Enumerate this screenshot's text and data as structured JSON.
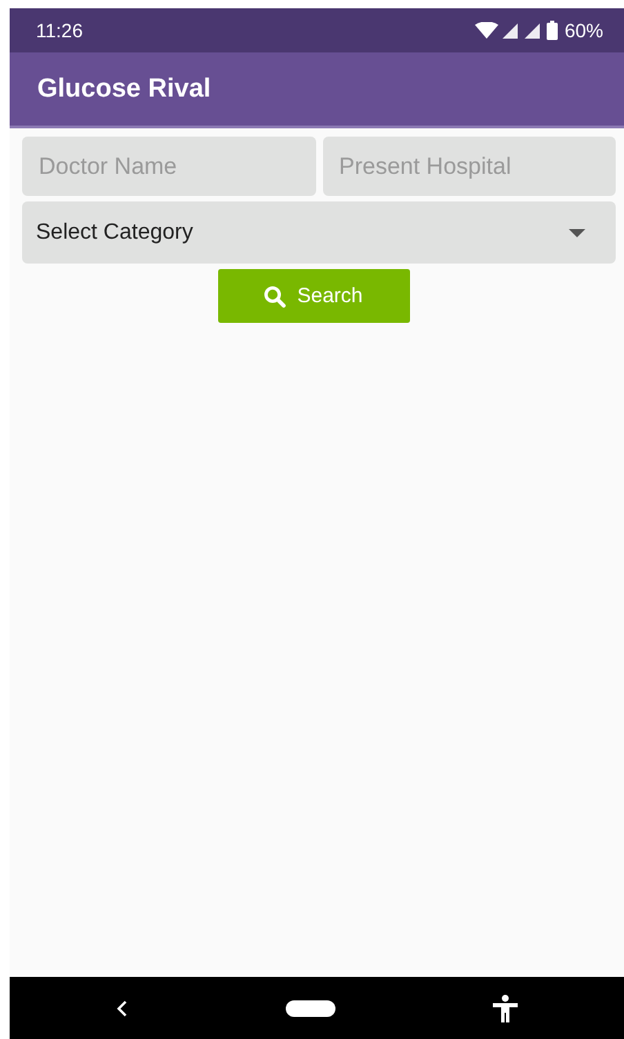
{
  "status_bar": {
    "time": "11:26",
    "battery": "60%"
  },
  "app_bar": {
    "title": "Glucose Rival"
  },
  "form": {
    "doctor_name": {
      "placeholder": "Doctor Name"
    },
    "present_hospital": {
      "placeholder": "Present Hospital"
    },
    "category": {
      "value": "Select Category"
    },
    "search_button": {
      "label": "Search"
    }
  }
}
